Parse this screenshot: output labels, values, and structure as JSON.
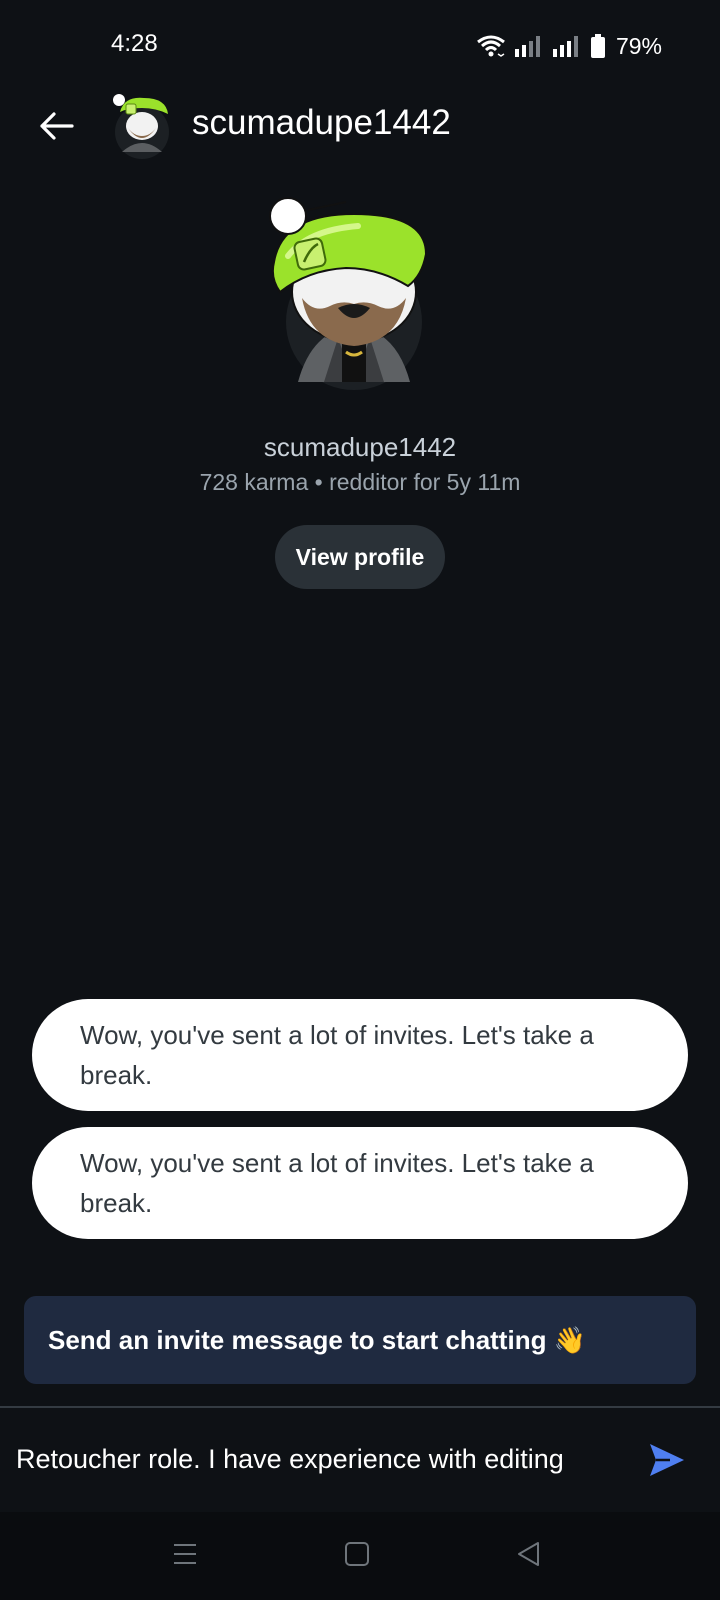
{
  "status_bar": {
    "time": "4:28",
    "battery_percent": "79%",
    "icons": [
      "wifi-icon",
      "signal-icon",
      "signal-icon",
      "battery-icon"
    ]
  },
  "header": {
    "title": "scumadupe1442",
    "back_icon": "arrow-left-icon",
    "avatar": "snoo-avatar-green-beanie"
  },
  "profile": {
    "username": "scumadupe1442",
    "meta": "728 karma • redditor for 5y 11m",
    "view_profile_label": "View profile"
  },
  "messages": [
    {
      "text": "Wow, you've sent a lot of invites. Let's take a break."
    },
    {
      "text": "Wow, you've sent a lot of invites. Let's take a break."
    }
  ],
  "invite_banner": {
    "text": "Send an invite message to start chatting 👋"
  },
  "composer": {
    "value": "Retoucher role. I have experience with editing",
    "send_icon": "send-icon"
  },
  "nav_bar": {
    "icons": [
      "menu-icon",
      "home-square-icon",
      "back-triangle-icon"
    ]
  },
  "colors": {
    "background": "#0e1115",
    "accent": "#4f7ff0",
    "beanie": "#9be22b",
    "banner": "#1f2a40"
  }
}
